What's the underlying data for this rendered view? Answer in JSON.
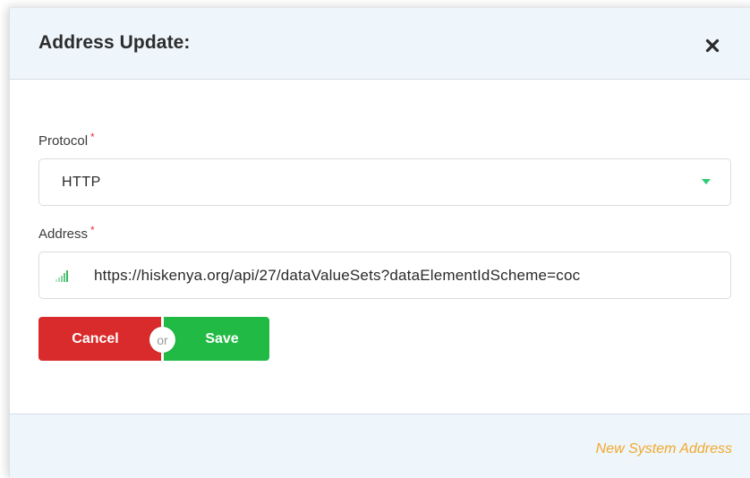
{
  "modal": {
    "title": "Address Update:",
    "close_icon": "close-icon"
  },
  "form": {
    "protocol": {
      "label": "Protocol",
      "required_mark": "*",
      "value": "HTTP",
      "arrow_icon": "dropdown-arrow-icon"
    },
    "address": {
      "label": "Address",
      "required_mark": "*",
      "value": "https://hiskenya.org/api/27/dataValueSets?dataElementIdScheme=coc",
      "icon": "signal-strength-icon"
    }
  },
  "actions": {
    "cancel_label": "Cancel",
    "or_label": "or",
    "save_label": "Save"
  },
  "footer": {
    "link_label": "New System Address"
  },
  "colors": {
    "header_bg": "#eef5fb",
    "cancel": "#d92b2b",
    "save": "#21ba45",
    "required": "#e03a3a",
    "dropdown_arrow": "#2ecc71",
    "footer_link": "#f2a92b"
  }
}
